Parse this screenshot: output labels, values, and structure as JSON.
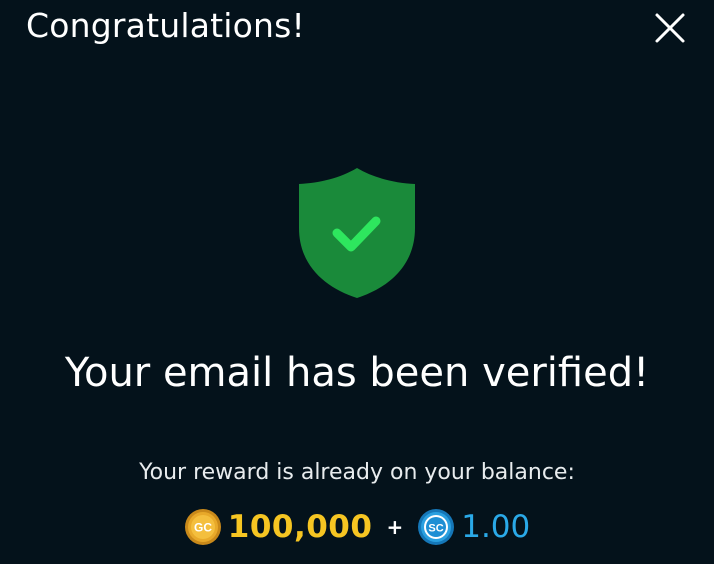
{
  "modal": {
    "title": "Congratulations!",
    "close_icon": "close-icon"
  },
  "status": {
    "icon": "shield-check-icon",
    "headline": "Your email has been verified!",
    "subtext": "Your reward is already on your balance:"
  },
  "rewards": {
    "gold_coin": {
      "badge": "GC",
      "amount": "100,000",
      "color": "#f6c522"
    },
    "separator": "+",
    "sweeps_coin": {
      "badge": "SC",
      "amount": "1.00",
      "color": "#2aa9e8"
    }
  },
  "colors": {
    "background": "#04121b",
    "shield": "#1a8a3a",
    "check": "#2ee65e"
  }
}
